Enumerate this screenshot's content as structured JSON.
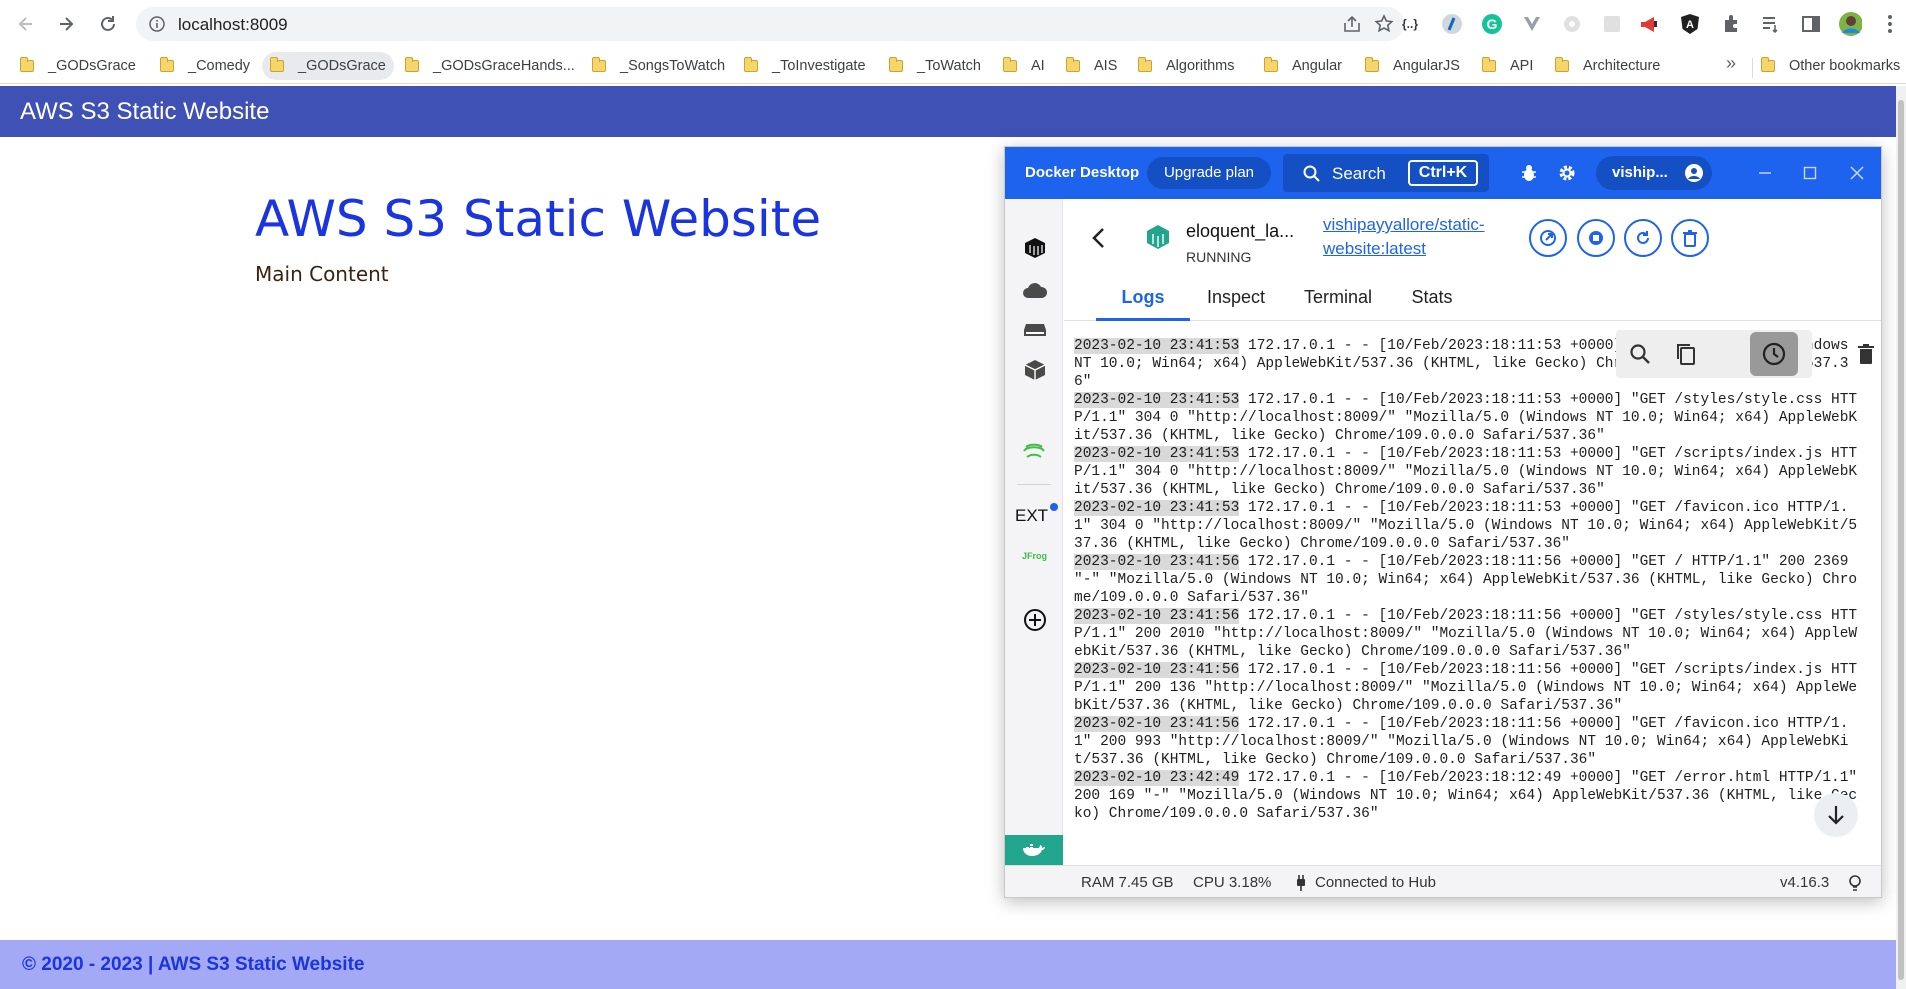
{
  "browser": {
    "url": "localhost:8009",
    "bookmarks": [
      {
        "label": "_GODsGrace"
      },
      {
        "label": "_Comedy"
      },
      {
        "label": "_GODsGrace"
      },
      {
        "label": "_GODsGraceHands..."
      },
      {
        "label": "_SongsToWatch"
      },
      {
        "label": "_ToInvestigate"
      },
      {
        "label": "_ToWatch"
      },
      {
        "label": "AI"
      },
      {
        "label": "AIS"
      },
      {
        "label": "Algorithms"
      },
      {
        "label": "Angular"
      },
      {
        "label": "AngularJS"
      },
      {
        "label": "API"
      },
      {
        "label": "Architecture"
      }
    ],
    "overflow_glyph": "»",
    "other_bookmarks": "Other bookmarks"
  },
  "site": {
    "header_title": "AWS S3 Static Website",
    "heading": "AWS S3 Static Website",
    "main_text": "Main Content",
    "footer_text": "© 2020 - 2023 | AWS S3 Static Website"
  },
  "docker": {
    "app_name": "Docker Desktop",
    "upgrade_label": "Upgrade plan",
    "search_label": "Search",
    "search_shortcut": "Ctrl+K",
    "user_name": "viship...",
    "container": {
      "name": "eloquent_la...",
      "status": "RUNNING",
      "image": "vishipayyallore/static-website:latest"
    },
    "tabs": [
      "Logs",
      "Inspect",
      "Terminal",
      "Stats"
    ],
    "active_tab": "Logs",
    "sidebar_ext_label": "EXT",
    "sidebar_jfrog_label": "JFrog",
    "logs": [
      {
        "ts": "2023-02-10 23:41:53",
        "text": " 172.17.0.1 - - [10/Feb/2023:18:11:53 +0000] \"-\" \"Mozilla/5.0 (Windows NT 10.0; Win64; x64) AppleWebKit/537.36 (KHTML, like Gecko) Chrome/109.0.0.0 Safari/537.36\""
      },
      {
        "ts": "2023-02-10 23:41:53",
        "text": " 172.17.0.1 - - [10/Feb/2023:18:11:53 +0000] \"GET /styles/style.css HTTP/1.1\" 304 0 \"http://localhost:8009/\" \"Mozilla/5.0 (Windows NT 10.0; Win64; x64) AppleWebKit/537.36 (KHTML, like Gecko) Chrome/109.0.0.0 Safari/537.36\""
      },
      {
        "ts": "2023-02-10 23:41:53",
        "text": " 172.17.0.1 - - [10/Feb/2023:18:11:53 +0000] \"GET /scripts/index.js HTTP/1.1\" 304 0 \"http://localhost:8009/\" \"Mozilla/5.0 (Windows NT 10.0; Win64; x64) AppleWebKit/537.36 (KHTML, like Gecko) Chrome/109.0.0.0 Safari/537.36\""
      },
      {
        "ts": "2023-02-10 23:41:53",
        "text": " 172.17.0.1 - - [10/Feb/2023:18:11:53 +0000] \"GET /favicon.ico HTTP/1.1\" 304 0 \"http://localhost:8009/\" \"Mozilla/5.0 (Windows NT 10.0; Win64; x64) AppleWebKit/537.36 (KHTML, like Gecko) Chrome/109.0.0.0 Safari/537.36\""
      },
      {
        "ts": "2023-02-10 23:41:56",
        "text": " 172.17.0.1 - - [10/Feb/2023:18:11:56 +0000] \"GET / HTTP/1.1\" 200 2369 \"-\" \"Mozilla/5.0 (Windows NT 10.0; Win64; x64) AppleWebKit/537.36 (KHTML, like Gecko) Chrome/109.0.0.0 Safari/537.36\""
      },
      {
        "ts": "2023-02-10 23:41:56",
        "text": " 172.17.0.1 - - [10/Feb/2023:18:11:56 +0000] \"GET /styles/style.css HTTP/1.1\" 200 2010 \"http://localhost:8009/\" \"Mozilla/5.0 (Windows NT 10.0; Win64; x64) AppleWebKit/537.36 (KHTML, like Gecko) Chrome/109.0.0.0 Safari/537.36\""
      },
      {
        "ts": "2023-02-10 23:41:56",
        "text": " 172.17.0.1 - - [10/Feb/2023:18:11:56 +0000] \"GET /scripts/index.js HTTP/1.1\" 200 136 \"http://localhost:8009/\" \"Mozilla/5.0 (Windows NT 10.0; Win64; x64) AppleWebKit/537.36 (KHTML, like Gecko) Chrome/109.0.0.0 Safari/537.36\""
      },
      {
        "ts": "2023-02-10 23:41:56",
        "text": " 172.17.0.1 - - [10/Feb/2023:18:11:56 +0000] \"GET /favicon.ico HTTP/1.1\" 200 993 \"http://localhost:8009/\" \"Mozilla/5.0 (Windows NT 10.0; Win64; x64) AppleWebKit/537.36 (KHTML, like Gecko) Chrome/109.0.0.0 Safari/537.36\""
      },
      {
        "ts": "2023-02-10 23:42:49",
        "text": " 172.17.0.1 - - [10/Feb/2023:18:12:49 +0000] \"GET /error.html HTTP/1.1\" 200 169 \"-\" \"Mozilla/5.0 (Windows NT 10.0; Win64; x64) AppleWebKit/537.36 (KHTML, like Gecko) Chrome/109.0.0.0 Safari/537.36\""
      }
    ],
    "status": {
      "ram": "RAM 7.45 GB",
      "cpu": "CPU 3.18%",
      "hub": "Connected to Hub",
      "version": "v4.16.3"
    }
  },
  "colors": {
    "site_header": "#3f51b5",
    "site_footer": "#a3a9f5",
    "docker_blue": "#1d63ed",
    "docker_green": "#21a58c"
  }
}
